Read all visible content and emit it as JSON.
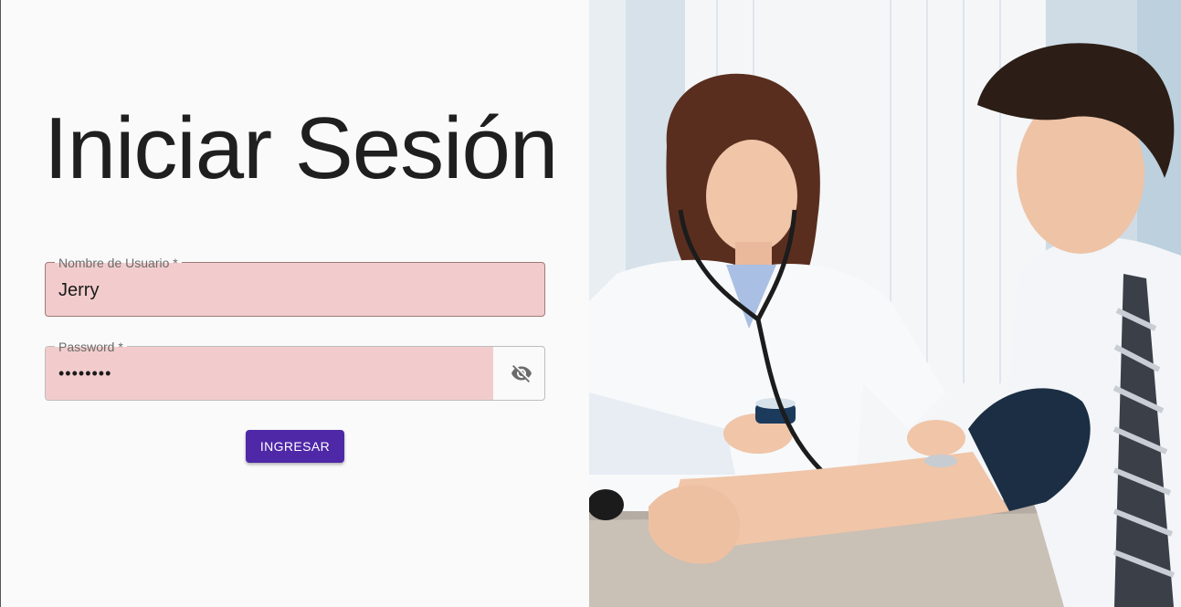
{
  "login": {
    "title": "Iniciar Sesión",
    "username": {
      "label": "Nombre de Usuario *",
      "value": "Jerry"
    },
    "password": {
      "label": "Password *",
      "value": "••••••••",
      "toggle_icon": "eye-off-icon"
    },
    "submit_label": "INGRESAR"
  },
  "hero_image": {
    "description_icon": "doctor-patient-photo"
  },
  "colors": {
    "background": "#fafafa",
    "field_fill": "#f2cccc",
    "button": "#4f28a8",
    "title_text": "#1f1f1f"
  }
}
